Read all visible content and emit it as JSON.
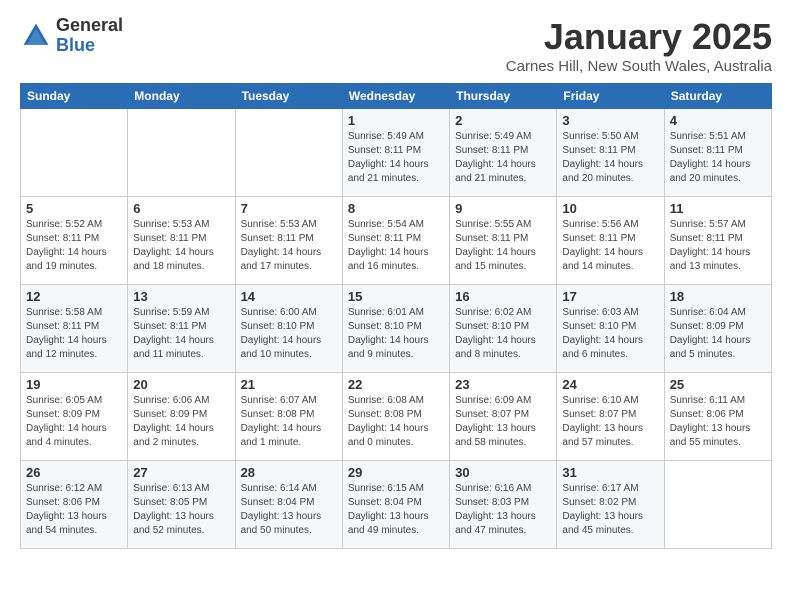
{
  "header": {
    "logo_general": "General",
    "logo_blue": "Blue",
    "month_title": "January 2025",
    "location": "Carnes Hill, New South Wales, Australia"
  },
  "weekdays": [
    "Sunday",
    "Monday",
    "Tuesday",
    "Wednesday",
    "Thursday",
    "Friday",
    "Saturday"
  ],
  "weeks": [
    [
      {
        "date": "",
        "sunrise": "",
        "sunset": "",
        "daylight": ""
      },
      {
        "date": "",
        "sunrise": "",
        "sunset": "",
        "daylight": ""
      },
      {
        "date": "",
        "sunrise": "",
        "sunset": "",
        "daylight": ""
      },
      {
        "date": "1",
        "sunrise": "Sunrise: 5:49 AM",
        "sunset": "Sunset: 8:11 PM",
        "daylight": "Daylight: 14 hours and 21 minutes."
      },
      {
        "date": "2",
        "sunrise": "Sunrise: 5:49 AM",
        "sunset": "Sunset: 8:11 PM",
        "daylight": "Daylight: 14 hours and 21 minutes."
      },
      {
        "date": "3",
        "sunrise": "Sunrise: 5:50 AM",
        "sunset": "Sunset: 8:11 PM",
        "daylight": "Daylight: 14 hours and 20 minutes."
      },
      {
        "date": "4",
        "sunrise": "Sunrise: 5:51 AM",
        "sunset": "Sunset: 8:11 PM",
        "daylight": "Daylight: 14 hours and 20 minutes."
      }
    ],
    [
      {
        "date": "5",
        "sunrise": "Sunrise: 5:52 AM",
        "sunset": "Sunset: 8:11 PM",
        "daylight": "Daylight: 14 hours and 19 minutes."
      },
      {
        "date": "6",
        "sunrise": "Sunrise: 5:53 AM",
        "sunset": "Sunset: 8:11 PM",
        "daylight": "Daylight: 14 hours and 18 minutes."
      },
      {
        "date": "7",
        "sunrise": "Sunrise: 5:53 AM",
        "sunset": "Sunset: 8:11 PM",
        "daylight": "Daylight: 14 hours and 17 minutes."
      },
      {
        "date": "8",
        "sunrise": "Sunrise: 5:54 AM",
        "sunset": "Sunset: 8:11 PM",
        "daylight": "Daylight: 14 hours and 16 minutes."
      },
      {
        "date": "9",
        "sunrise": "Sunrise: 5:55 AM",
        "sunset": "Sunset: 8:11 PM",
        "daylight": "Daylight: 14 hours and 15 minutes."
      },
      {
        "date": "10",
        "sunrise": "Sunrise: 5:56 AM",
        "sunset": "Sunset: 8:11 PM",
        "daylight": "Daylight: 14 hours and 14 minutes."
      },
      {
        "date": "11",
        "sunrise": "Sunrise: 5:57 AM",
        "sunset": "Sunset: 8:11 PM",
        "daylight": "Daylight: 14 hours and 13 minutes."
      }
    ],
    [
      {
        "date": "12",
        "sunrise": "Sunrise: 5:58 AM",
        "sunset": "Sunset: 8:11 PM",
        "daylight": "Daylight: 14 hours and 12 minutes."
      },
      {
        "date": "13",
        "sunrise": "Sunrise: 5:59 AM",
        "sunset": "Sunset: 8:11 PM",
        "daylight": "Daylight: 14 hours and 11 minutes."
      },
      {
        "date": "14",
        "sunrise": "Sunrise: 6:00 AM",
        "sunset": "Sunset: 8:10 PM",
        "daylight": "Daylight: 14 hours and 10 minutes."
      },
      {
        "date": "15",
        "sunrise": "Sunrise: 6:01 AM",
        "sunset": "Sunset: 8:10 PM",
        "daylight": "Daylight: 14 hours and 9 minutes."
      },
      {
        "date": "16",
        "sunrise": "Sunrise: 6:02 AM",
        "sunset": "Sunset: 8:10 PM",
        "daylight": "Daylight: 14 hours and 8 minutes."
      },
      {
        "date": "17",
        "sunrise": "Sunrise: 6:03 AM",
        "sunset": "Sunset: 8:10 PM",
        "daylight": "Daylight: 14 hours and 6 minutes."
      },
      {
        "date": "18",
        "sunrise": "Sunrise: 6:04 AM",
        "sunset": "Sunset: 8:09 PM",
        "daylight": "Daylight: 14 hours and 5 minutes."
      }
    ],
    [
      {
        "date": "19",
        "sunrise": "Sunrise: 6:05 AM",
        "sunset": "Sunset: 8:09 PM",
        "daylight": "Daylight: 14 hours and 4 minutes."
      },
      {
        "date": "20",
        "sunrise": "Sunrise: 6:06 AM",
        "sunset": "Sunset: 8:09 PM",
        "daylight": "Daylight: 14 hours and 2 minutes."
      },
      {
        "date": "21",
        "sunrise": "Sunrise: 6:07 AM",
        "sunset": "Sunset: 8:08 PM",
        "daylight": "Daylight: 14 hours and 1 minute."
      },
      {
        "date": "22",
        "sunrise": "Sunrise: 6:08 AM",
        "sunset": "Sunset: 8:08 PM",
        "daylight": "Daylight: 14 hours and 0 minutes."
      },
      {
        "date": "23",
        "sunrise": "Sunrise: 6:09 AM",
        "sunset": "Sunset: 8:07 PM",
        "daylight": "Daylight: 13 hours and 58 minutes."
      },
      {
        "date": "24",
        "sunrise": "Sunrise: 6:10 AM",
        "sunset": "Sunset: 8:07 PM",
        "daylight": "Daylight: 13 hours and 57 minutes."
      },
      {
        "date": "25",
        "sunrise": "Sunrise: 6:11 AM",
        "sunset": "Sunset: 8:06 PM",
        "daylight": "Daylight: 13 hours and 55 minutes."
      }
    ],
    [
      {
        "date": "26",
        "sunrise": "Sunrise: 6:12 AM",
        "sunset": "Sunset: 8:06 PM",
        "daylight": "Daylight: 13 hours and 54 minutes."
      },
      {
        "date": "27",
        "sunrise": "Sunrise: 6:13 AM",
        "sunset": "Sunset: 8:05 PM",
        "daylight": "Daylight: 13 hours and 52 minutes."
      },
      {
        "date": "28",
        "sunrise": "Sunrise: 6:14 AM",
        "sunset": "Sunset: 8:04 PM",
        "daylight": "Daylight: 13 hours and 50 minutes."
      },
      {
        "date": "29",
        "sunrise": "Sunrise: 6:15 AM",
        "sunset": "Sunset: 8:04 PM",
        "daylight": "Daylight: 13 hours and 49 minutes."
      },
      {
        "date": "30",
        "sunrise": "Sunrise: 6:16 AM",
        "sunset": "Sunset: 8:03 PM",
        "daylight": "Daylight: 13 hours and 47 minutes."
      },
      {
        "date": "31",
        "sunrise": "Sunrise: 6:17 AM",
        "sunset": "Sunset: 8:02 PM",
        "daylight": "Daylight: 13 hours and 45 minutes."
      },
      {
        "date": "",
        "sunrise": "",
        "sunset": "",
        "daylight": ""
      }
    ]
  ]
}
